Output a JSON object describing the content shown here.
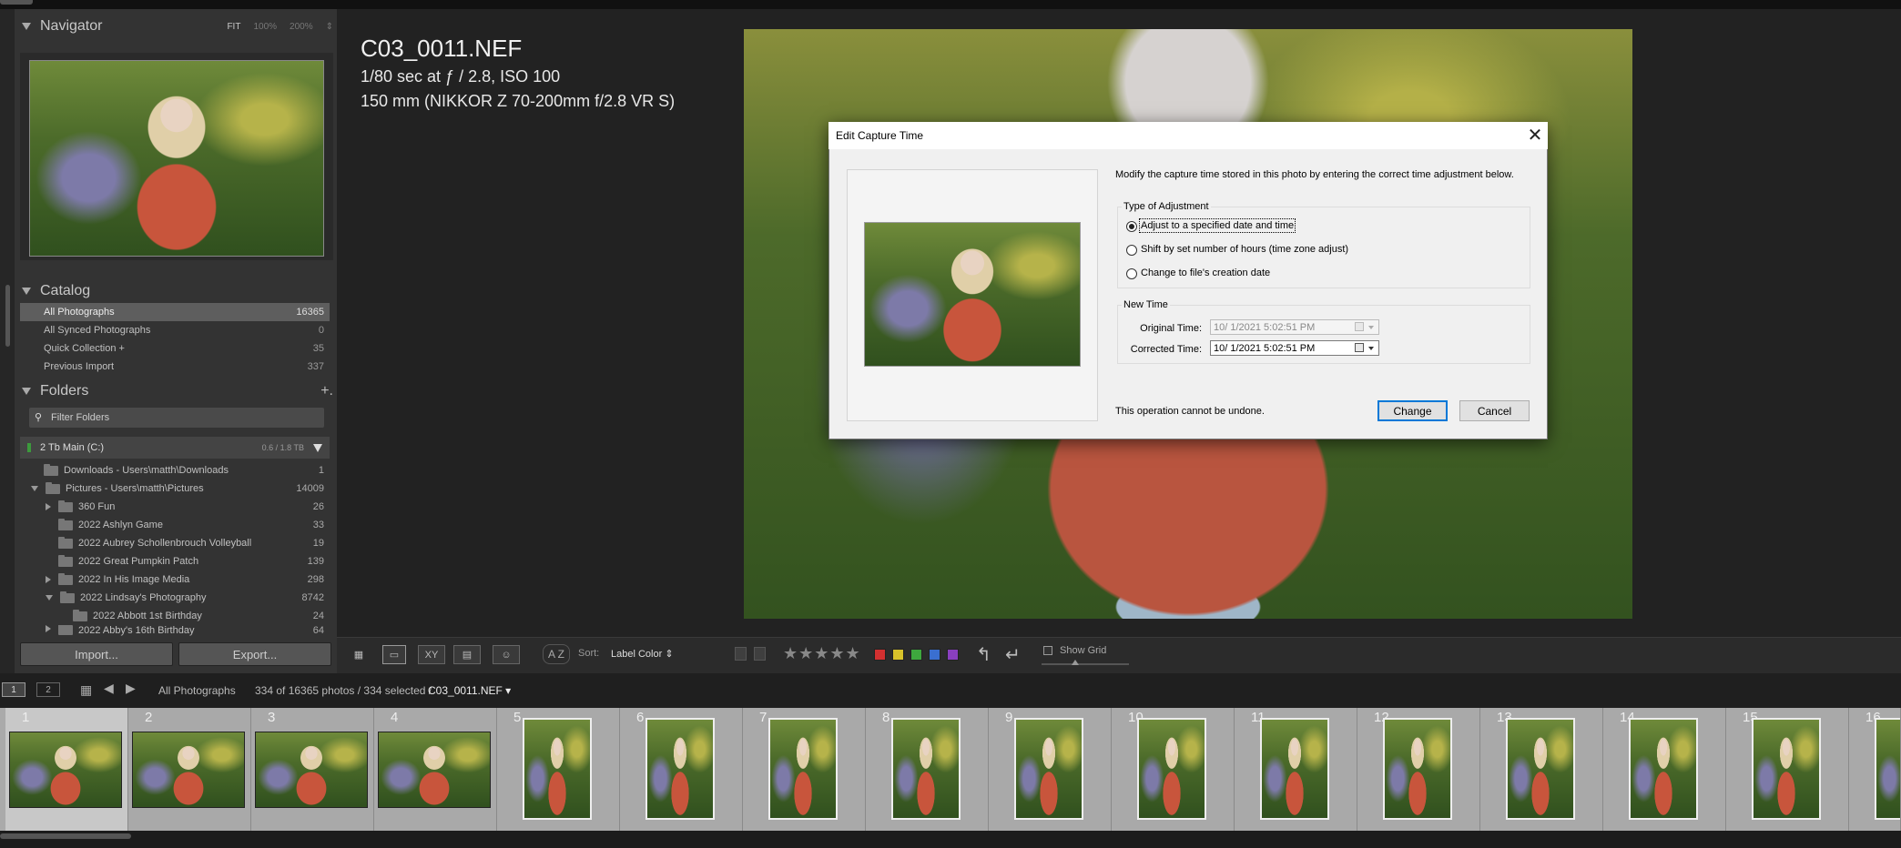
{
  "navigator": {
    "title": "Navigator",
    "zoom_fit": "FIT",
    "zoom_100": "100%",
    "zoom_200": "200%",
    "zoom_more": "⇕"
  },
  "catalog": {
    "title": "Catalog",
    "items": [
      {
        "label": "All Photographs",
        "count": "16365",
        "selected": true
      },
      {
        "label": "All Synced Photographs",
        "count": "0"
      },
      {
        "label": "Quick Collection +",
        "count": "35"
      },
      {
        "label": "Previous Import",
        "count": "337"
      }
    ]
  },
  "folders": {
    "title": "Folders",
    "plus": "+.",
    "filter_placeholder": "Filter Folders",
    "volume": {
      "name": "2 Tb Main (C:)",
      "size": "0.6 / 1.8 TB"
    },
    "items": [
      {
        "label": "Downloads - Users\\matth\\Downloads",
        "count": "1"
      },
      {
        "label": "Pictures - Users\\matth\\Pictures",
        "count": "14009"
      },
      {
        "label": "360 Fun",
        "count": "26"
      },
      {
        "label": "2022 Ashlyn Game",
        "count": "33"
      },
      {
        "label": "2022 Aubrey Schollenbrouch Volleyball",
        "count": "19"
      },
      {
        "label": "2022 Great Pumpkin Patch",
        "count": "139"
      },
      {
        "label": "2022 In His Image Media",
        "count": "298"
      },
      {
        "label": "2022 Lindsay's Photography",
        "count": "8742"
      },
      {
        "label": "2022 Abbott 1st Birthday",
        "count": "24"
      },
      {
        "label": "2022 Abby's 16th Birthday",
        "count": "64"
      }
    ]
  },
  "buttons": {
    "import": "Import...",
    "export": "Export..."
  },
  "photo_info": {
    "filename": "C03_0011.NEF",
    "exposure": "1/80 sec at ƒ / 2.8, ISO 100",
    "lens": "150 mm (NIKKOR Z 70-200mm f/2.8 VR S)"
  },
  "toolbar": {
    "sort_icon": "A Z",
    "sort_label": "Sort:",
    "sort_value": "Label Color ⇕",
    "stars": "★★★★★",
    "rotate_left": "↰",
    "rotate_right": "↵",
    "show_grid": "Show Grid",
    "label_colors": [
      "#d23030",
      "#d8c22a",
      "#3ea83e",
      "#3a6fd0",
      "#8a3fbf"
    ]
  },
  "filmstrip_bar": {
    "monitor1": "1",
    "monitor2": "2",
    "grid_icon": "▦",
    "back": "◀",
    "forward": "▶",
    "source": "All Photographs",
    "count": "334 of 16365 photos / 334 selected /",
    "file": "C03_0011.NEF ▾"
  },
  "filmstrip": {
    "cells": [
      {
        "num": "1",
        "orientation": "landscape",
        "selected": true
      },
      {
        "num": "2",
        "orientation": "landscape"
      },
      {
        "num": "3",
        "orientation": "landscape"
      },
      {
        "num": "4",
        "orientation": "landscape"
      },
      {
        "num": "5",
        "orientation": "portrait"
      },
      {
        "num": "6",
        "orientation": "portrait"
      },
      {
        "num": "7",
        "orientation": "portrait"
      },
      {
        "num": "8",
        "orientation": "portrait"
      },
      {
        "num": "9",
        "orientation": "portrait"
      },
      {
        "num": "10",
        "orientation": "portrait"
      },
      {
        "num": "11",
        "orientation": "portrait"
      },
      {
        "num": "12",
        "orientation": "portrait"
      },
      {
        "num": "13",
        "orientation": "portrait"
      },
      {
        "num": "14",
        "orientation": "portrait"
      },
      {
        "num": "15",
        "orientation": "portrait"
      },
      {
        "num": "16",
        "orientation": "portrait"
      }
    ]
  },
  "dialog": {
    "title": "Edit Capture Time",
    "close": "✕",
    "message": "Modify the capture time stored in this photo by entering the correct time adjustment below.",
    "type_group": "Type of Adjustment",
    "options": [
      {
        "label": "Adjust to a specified date and time",
        "checked": true
      },
      {
        "label": "Shift by set number of hours (time zone adjust)"
      },
      {
        "label": "Change to file's creation date"
      }
    ],
    "new_time_group": "New Time",
    "original_label": "Original Time:",
    "original_value": "10/  1/2021   5:02:51 PM",
    "corrected_label": "Corrected Time:",
    "corrected_value": "10/  1/2021   5:02:51 PM",
    "warning": "This operation cannot be undone.",
    "change": "Change",
    "cancel": "Cancel"
  }
}
